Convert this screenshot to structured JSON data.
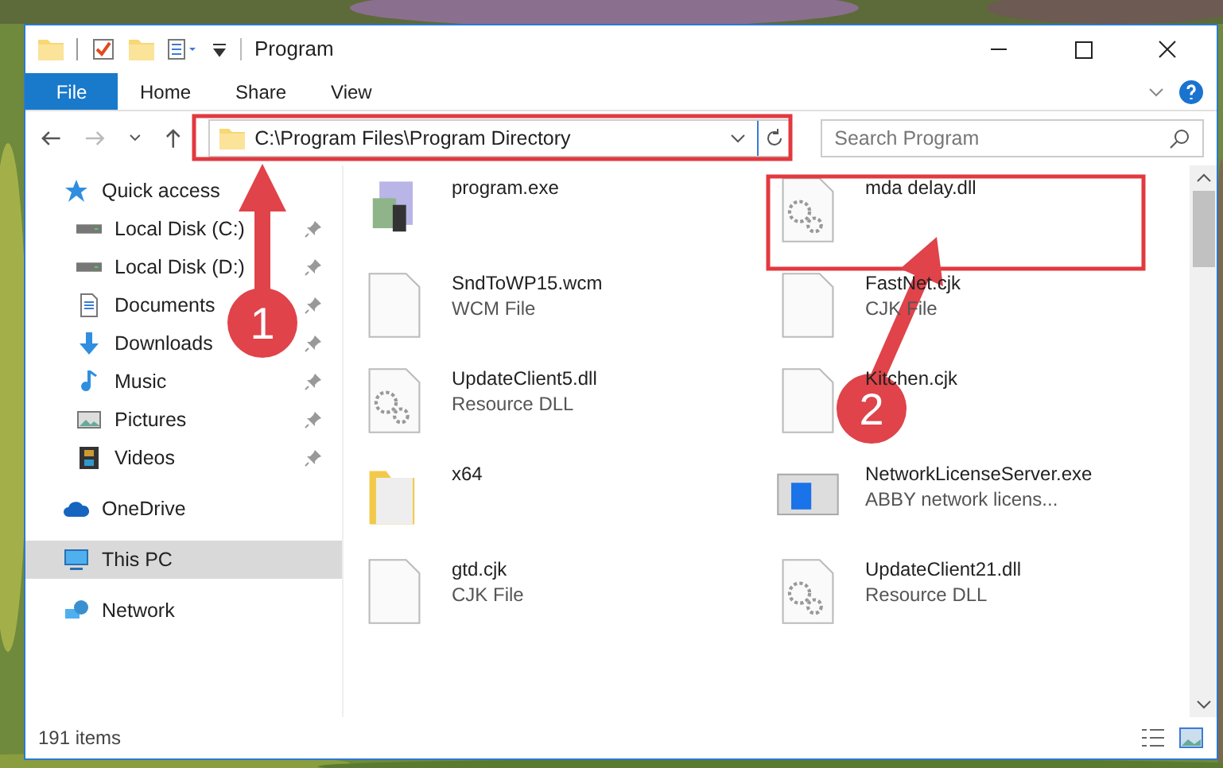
{
  "window": {
    "title": "Program"
  },
  "ribbon_tabs": [
    {
      "label": "File",
      "kind": "file"
    },
    {
      "label": "Home",
      "kind": "tab"
    },
    {
      "label": "Share",
      "kind": "tab"
    },
    {
      "label": "View",
      "kind": "tab"
    }
  ],
  "address": {
    "path": "C:\\Program Files\\Program Directory"
  },
  "search": {
    "placeholder": "Search Program"
  },
  "nav": [
    {
      "label": "Quick access",
      "kind": "star",
      "selected": false,
      "children": [
        {
          "label": "Local Disk (C:)",
          "kind": "disk",
          "pinned": true
        },
        {
          "label": "Local Disk (D:)",
          "kind": "disk",
          "pinned": true
        },
        {
          "label": "Documents",
          "kind": "doc",
          "pinned": true
        },
        {
          "label": "Downloads",
          "kind": "download",
          "pinned": true
        },
        {
          "label": "Music",
          "kind": "music",
          "pinned": true
        },
        {
          "label": "Pictures",
          "kind": "pictures",
          "pinned": true
        },
        {
          "label": "Videos",
          "kind": "videos",
          "pinned": true
        }
      ]
    },
    {
      "label": "OneDrive",
      "kind": "cloud",
      "selected": false
    },
    {
      "label": "This PC",
      "kind": "pc",
      "selected": true
    },
    {
      "label": "Network",
      "kind": "network",
      "selected": false
    }
  ],
  "files": [
    {
      "name": "program.exe",
      "kind": "exe"
    },
    {
      "name": "mda delay.dll",
      "kind": "dll"
    },
    {
      "name": "SndToWP15.wcm",
      "type": "WCM File",
      "kind": "file"
    },
    {
      "name": "FastNet.cjk",
      "type": "CJK File",
      "kind": "file"
    },
    {
      "name": "UpdateClient5.dll",
      "type": "Resource DLL",
      "kind": "dll"
    },
    {
      "name": "Kitchen.cjk",
      "kind": "file"
    },
    {
      "name": "x64",
      "kind": "folder"
    },
    {
      "name": "NetworkLicenseServer.exe",
      "type": "ABBY network licens...",
      "kind": "app"
    },
    {
      "name": "gtd.cjk",
      "type": "CJK File",
      "kind": "file"
    },
    {
      "name": "UpdateClient21.dll",
      "type": "Resource DLL",
      "kind": "dll"
    }
  ],
  "status_bar": {
    "count": "191 items"
  },
  "annotations": [
    {
      "label": "1"
    },
    {
      "label": "2"
    }
  ]
}
